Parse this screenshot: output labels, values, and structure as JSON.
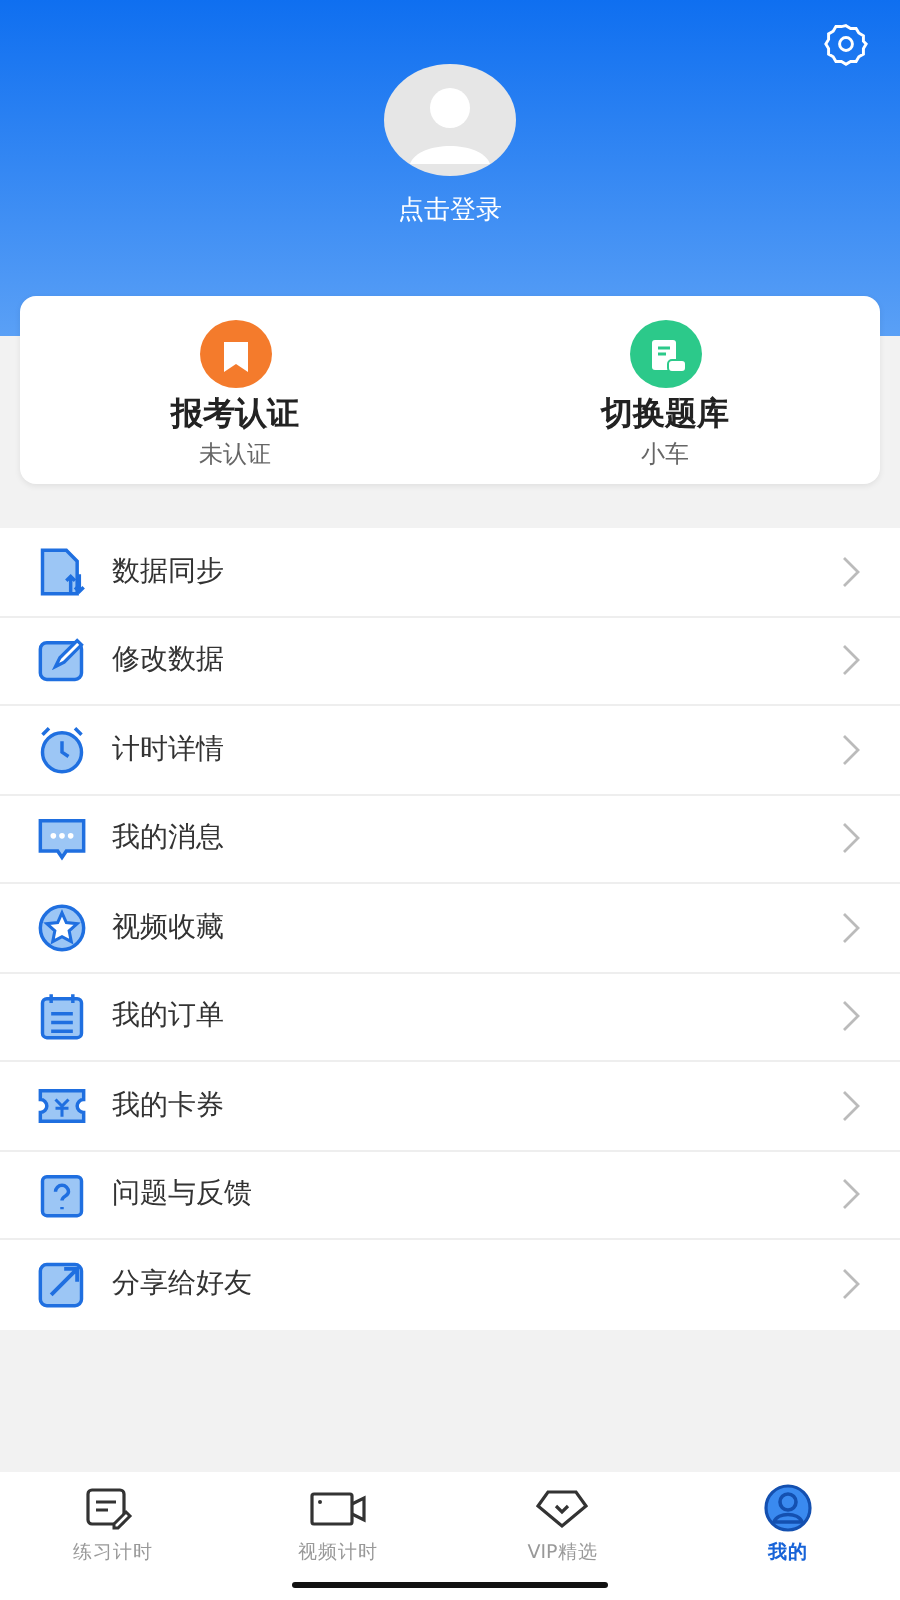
{
  "header": {
    "login": "点击登录"
  },
  "cards": [
    {
      "title": "报考认证",
      "subtitle": "未认证",
      "color": "#f47b2c"
    },
    {
      "title": "切换题库",
      "subtitle": "小车",
      "color": "#2cc98a"
    }
  ],
  "menu": [
    {
      "label": "数据同步"
    },
    {
      "label": "修改数据"
    },
    {
      "label": "计时详情"
    },
    {
      "label": "我的消息"
    },
    {
      "label": "视频收藏"
    },
    {
      "label": "我的订单"
    },
    {
      "label": "我的卡券"
    },
    {
      "label": "问题与反馈"
    },
    {
      "label": "分享给好友"
    }
  ],
  "tabs": [
    {
      "label": "练习计时",
      "selected": false
    },
    {
      "label": "视频计时",
      "selected": false
    },
    {
      "label": "VIP精选",
      "selected": false
    },
    {
      "label": "我的",
      "selected": true
    }
  ]
}
